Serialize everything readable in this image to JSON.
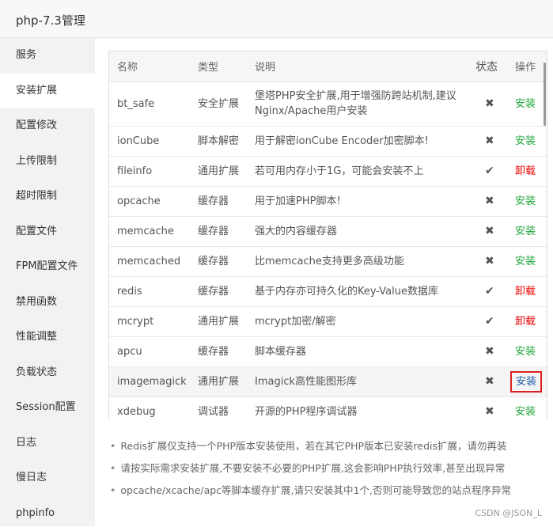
{
  "title": "php-7.3管理",
  "sidebar": {
    "items": [
      "服务",
      "安装扩展",
      "配置修改",
      "上传限制",
      "超时限制",
      "配置文件",
      "FPM配置文件",
      "禁用函数",
      "性能调整",
      "负载状态",
      "Session配置",
      "日志",
      "慢日志",
      "phpinfo"
    ],
    "active": 1
  },
  "table": {
    "headers": [
      "名称",
      "类型",
      "说明",
      "状态",
      "操作"
    ],
    "rows": [
      {
        "name": "bt_safe",
        "type": "安全扩展",
        "desc": "堡塔PHP安全扩展,用于增强防跨站机制,建议Nginx/Apache用户安装",
        "status": "✖",
        "action": "安装"
      },
      {
        "name": "ionCube",
        "type": "脚本解密",
        "desc": "用于解密ionCube Encoder加密脚本!",
        "status": "✖",
        "action": "安装"
      },
      {
        "name": "fileinfo",
        "type": "通用扩展",
        "desc": "若可用内存小于1G，可能会安装不上",
        "status": "✔",
        "action": "卸载"
      },
      {
        "name": "opcache",
        "type": "缓存器",
        "desc": "用于加速PHP脚本!",
        "status": "✖",
        "action": "安装"
      },
      {
        "name": "memcache",
        "type": "缓存器",
        "desc": "强大的内容缓存器",
        "status": "✖",
        "action": "安装"
      },
      {
        "name": "memcached",
        "type": "缓存器",
        "desc": "比memcache支持更多高级功能",
        "status": "✖",
        "action": "安装"
      },
      {
        "name": "redis",
        "type": "缓存器",
        "desc": "基于内存亦可持久化的Key-Value数据库",
        "status": "✔",
        "action": "卸载"
      },
      {
        "name": "mcrypt",
        "type": "通用扩展",
        "desc": "mcrypt加密/解密",
        "status": "✔",
        "action": "卸载"
      },
      {
        "name": "apcu",
        "type": "缓存器",
        "desc": "脚本缓存器",
        "status": "✖",
        "action": "安装"
      },
      {
        "name": "imagemagick",
        "type": "通用扩展",
        "desc": "Imagick高性能图形库",
        "status": "✖",
        "action": "安装"
      },
      {
        "name": "xdebug",
        "type": "调试器",
        "desc": "开源的PHP程序调试器",
        "status": "✖",
        "action": "安装"
      }
    ]
  },
  "notes": [
    "Redis扩展仅支持一个PHP版本安装使用，若在其它PHP版本已安装redis扩展，请勿再装",
    "请按实际需求安装扩展,不要安装不必要的PHP扩展,这会影响PHP执行效率,甚至出现异常",
    "opcache/xcache/apc等脚本缓存扩展,请只安装其中1个,否则可能导致您的站点程序异常"
  ],
  "watermark": "CSDN @JSON_L"
}
